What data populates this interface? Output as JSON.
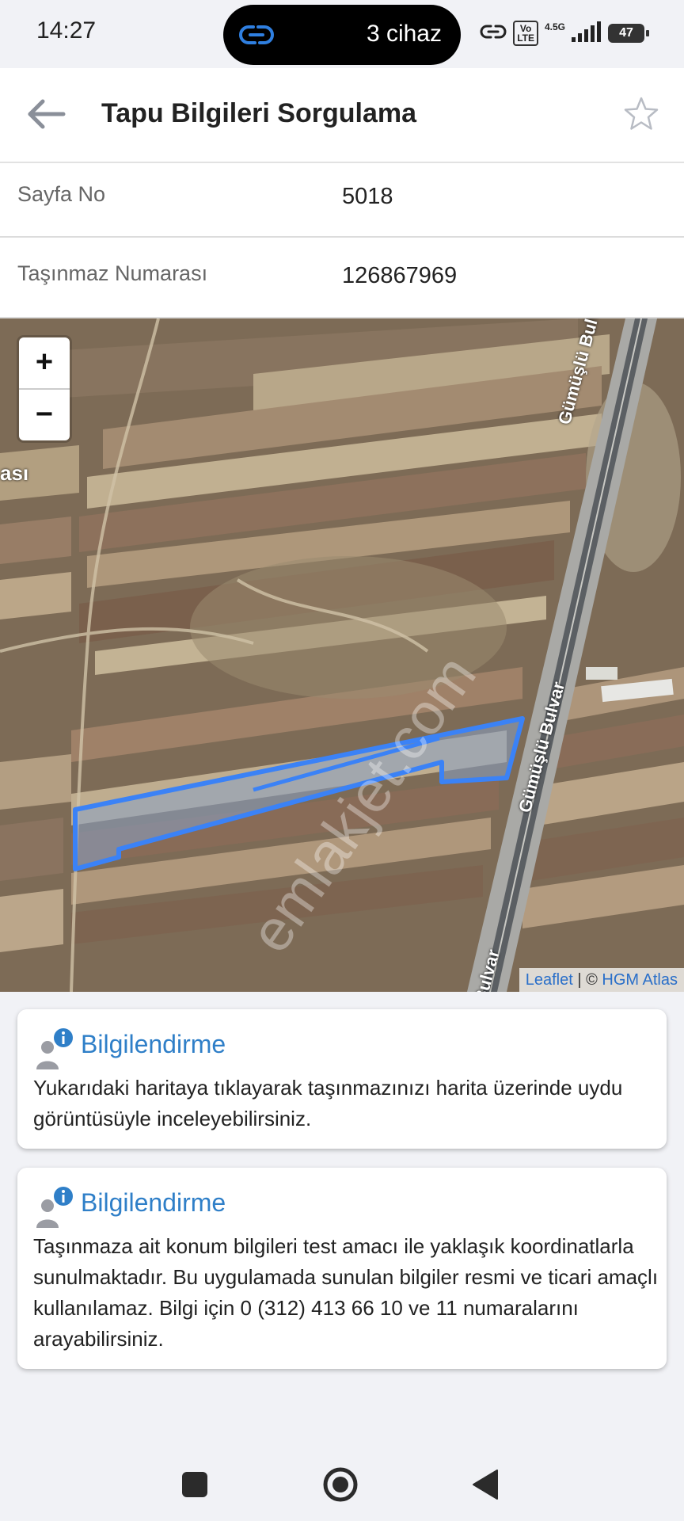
{
  "status_bar": {
    "time": "14:27",
    "pill_text": "3 cihaz",
    "network": "4.5G",
    "volte": "Vo\nLTE",
    "battery": "47",
    "icons": [
      "link-icon",
      "chain-icon",
      "volte-icon",
      "signal-icon",
      "battery-icon"
    ]
  },
  "header": {
    "title": "Tapu Bilgileri Sorgulama",
    "back_icon": "arrow-left-icon",
    "favorite_icon": "star-outline-icon"
  },
  "rows": [
    {
      "label": "Sayfa No",
      "value": "5018"
    },
    {
      "label": "Taşınmaz Numarası",
      "value": "126867969"
    }
  ],
  "map": {
    "zoom_in": "+",
    "zoom_out": "−",
    "road_label_1": "Gümüşlü Bulvar",
    "road_label_2": "Gümüşlü Bulvar",
    "road_label_3": "Bulvar",
    "place_fragment": "ası",
    "watermark": "emlakjet.com",
    "attribution_leaflet": "Leaflet",
    "attribution_sep": " | © ",
    "attribution_hgm": "HGM Atlas",
    "parcel_color": "#3b82f6"
  },
  "cards": [
    {
      "title": "Bilgilendirme",
      "body": "Yukarıdaki haritaya tıklayarak taşınmazınızı harita üzerinde uydu görüntüsüyle inceleyebilirsiniz."
    },
    {
      "title": "Bilgilendirme",
      "body": "Taşınmaza ait konum bilgileri test amacı ile yaklaşık koordinatlarla sunulmaktadır. Bu uygulamada sunulan bilgiler resmi ve ticari amaçlı kullanılamaz. Bilgi için 0 (312) 413 66 10 ve 11 numaralarını arayabilirsiniz."
    }
  ],
  "nav": {
    "icons": [
      "recents-square-icon",
      "home-circle-icon",
      "back-triangle-icon"
    ]
  },
  "colors": {
    "accent": "#2f7fc8",
    "background": "#f1f2f6"
  }
}
